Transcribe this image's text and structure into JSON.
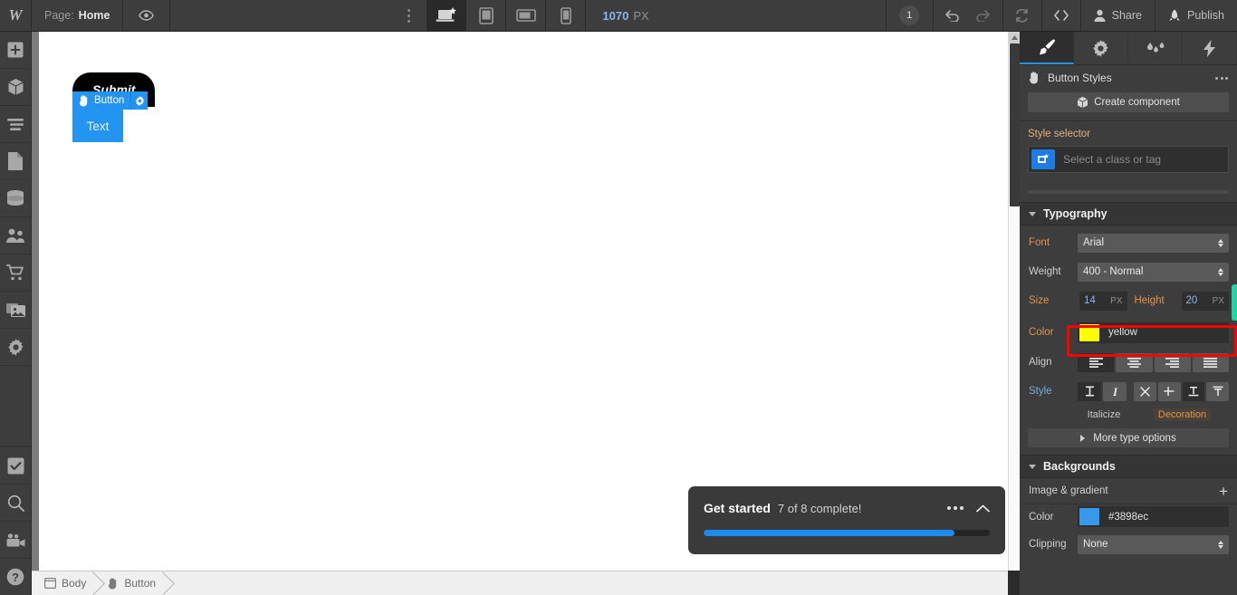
{
  "topbar": {
    "logo": "W",
    "page_label": "Page:",
    "page_value": "Home",
    "eye_icon": "eye-icon",
    "more_icon": "vertical-dots-icon",
    "devices": [
      {
        "name": "desktop",
        "icon": "desktop-icon",
        "active": true
      },
      {
        "name": "tablet",
        "icon": "tablet-portrait-icon",
        "active": false
      },
      {
        "name": "tablet-landscape",
        "icon": "tablet-landscape-icon",
        "active": false
      },
      {
        "name": "mobile",
        "icon": "mobile-icon",
        "active": false
      }
    ],
    "viewport_width": "1070",
    "viewport_unit": "PX",
    "collaborator_count": "1",
    "undo_icon": "undo-icon",
    "redo_icon": "redo-icon",
    "sync_icon": "refresh-icon",
    "code_icon": "code-brackets-icon",
    "share_label": "Share",
    "publish_label": "Publish"
  },
  "leftbar": {
    "items": [
      {
        "name": "add-elements",
        "icon": "plus-square-icon"
      },
      {
        "name": "components",
        "icon": "cube-icon"
      },
      {
        "name": "navigator",
        "icon": "layers-icon"
      },
      {
        "name": "pages",
        "icon": "page-icon"
      },
      {
        "name": "cms",
        "icon": "database-icon"
      },
      {
        "name": "users",
        "icon": "people-icon"
      },
      {
        "name": "ecommerce",
        "icon": "cart-icon"
      },
      {
        "name": "assets",
        "icon": "images-icon"
      },
      {
        "name": "settings",
        "icon": "gear-icon"
      }
    ],
    "bottom_items": [
      {
        "name": "audit",
        "icon": "checkmark-icon"
      },
      {
        "name": "search",
        "icon": "magnifier-icon"
      },
      {
        "name": "video",
        "icon": "video-camera-icon"
      },
      {
        "name": "help",
        "icon": "question-mark-icon"
      }
    ]
  },
  "canvas": {
    "submit_button_label": "Submit",
    "selection_badge": {
      "icon": "hand-icon",
      "label": "Button",
      "settings_icon": "gear-icon"
    },
    "text_block_label": "Text"
  },
  "getstarted": {
    "title": "Get started",
    "subtitle": "7 of 8 complete!",
    "more_icon": "horizontal-dots-icon",
    "collapse_icon": "chevron-up-icon",
    "progress_percent": 87.5
  },
  "breadcrumb": {
    "items": [
      {
        "icon": "browser-icon",
        "label": "Body"
      },
      {
        "icon": "hand-icon",
        "label": "Button"
      }
    ]
  },
  "rightpanel": {
    "tabs": [
      {
        "name": "style",
        "icon": "paint-brush-icon",
        "active": true
      },
      {
        "name": "settings",
        "icon": "gear-icon",
        "active": false
      },
      {
        "name": "interactions",
        "icon": "droplets-icon",
        "active": false
      },
      {
        "name": "effects",
        "icon": "lightning-bolt-icon",
        "active": false
      }
    ],
    "selector_title_icon": "hand-icon",
    "selector_title": "Button Styles",
    "more_icon": "horizontal-dots-icon",
    "create_component_label": "Create component",
    "create_component_icon": "cube-icon",
    "style_selector": {
      "label": "Style selector",
      "icon": "element-tag-icon",
      "placeholder": "Select a class or tag"
    },
    "typography": {
      "section_label": "Typography",
      "font_label": "Font",
      "font_value": "Arial",
      "weight_label": "Weight",
      "weight_value": "400 - Normal",
      "size_label": "Size",
      "size_value": "14",
      "size_unit": "PX",
      "height_label": "Height",
      "height_value": "20",
      "height_unit": "PX",
      "color_label": "Color",
      "color_value": "yellow",
      "color_swatch": "#ffff00",
      "align_label": "Align",
      "align_options": [
        {
          "name": "align-left",
          "icon": "align-left-icon",
          "selected": true
        },
        {
          "name": "align-center",
          "icon": "align-center-icon",
          "selected": false
        },
        {
          "name": "align-right",
          "icon": "align-right-icon",
          "selected": false
        },
        {
          "name": "align-justify",
          "icon": "align-justify-icon",
          "selected": false
        }
      ],
      "style_label": "Style",
      "style_options": [
        {
          "name": "uppercase",
          "icon": "uppercase-icon",
          "selected": true
        },
        {
          "name": "italicize",
          "icon": "italic-icon",
          "selected": false
        },
        {
          "name": "decoration-none",
          "icon": "x-icon",
          "selected": false
        },
        {
          "name": "strikethrough",
          "icon": "strikethrough-icon",
          "selected": false
        },
        {
          "name": "underline",
          "icon": "underline-icon",
          "selected": true
        },
        {
          "name": "overline",
          "icon": "overline-icon",
          "selected": false
        }
      ],
      "italicize_tooltip": "Italicize",
      "decoration_tooltip": "Decoration",
      "more_type_options": "More type options"
    },
    "backgrounds": {
      "section_label": "Backgrounds",
      "image_gradient_label": "Image & gradient",
      "add_icon": "plus-icon",
      "color_label": "Color",
      "color_value": "#3898ec",
      "color_swatch": "#3898ec",
      "clipping_label": "Clipping",
      "clipping_value": "None"
    }
  },
  "colors": {
    "accent_blue": "#2494f2",
    "panel_bg": "#3d3d3d",
    "highlight_red": "#fd0000",
    "highlight_green": "#1fd6a3",
    "label_orange": "#e0934f"
  }
}
